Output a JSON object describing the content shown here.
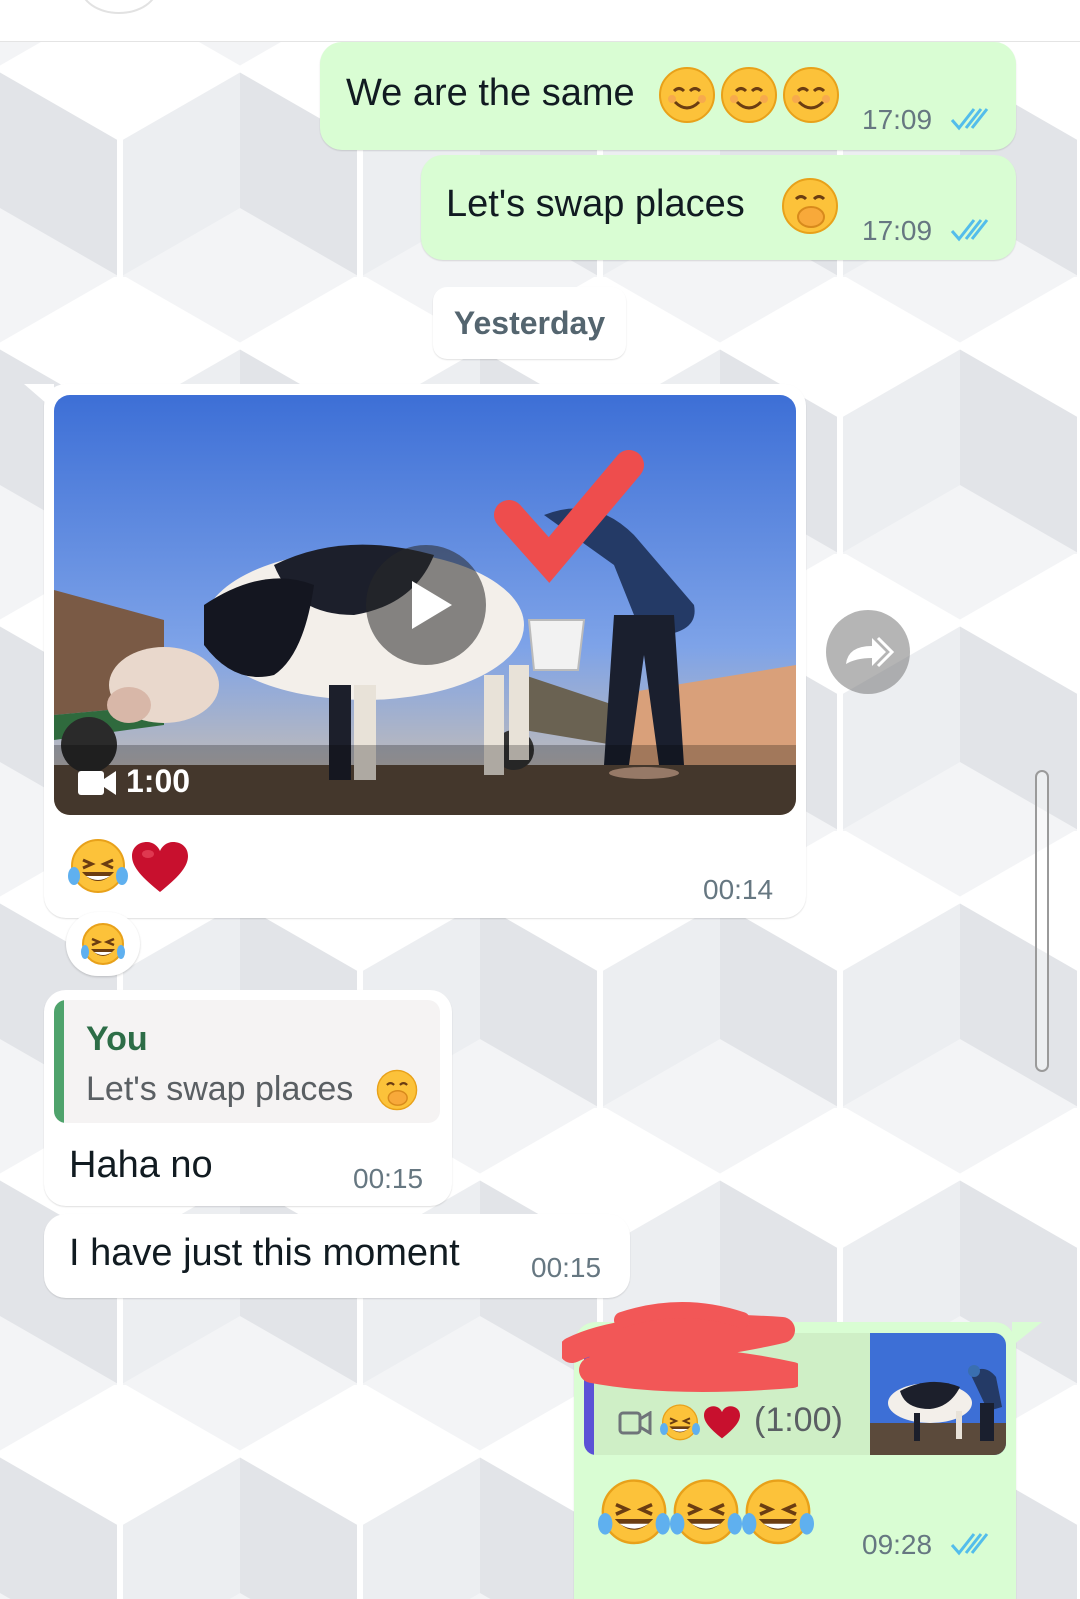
{
  "messages": [
    {
      "direction": "outgoing",
      "text": "We are the same",
      "emojis": [
        "smiling-face",
        "smiling-face",
        "smiling-face"
      ],
      "time": "17:09",
      "status": "read"
    },
    {
      "direction": "outgoing",
      "text": "Let's swap places",
      "emojis": [
        "face-with-hand-over-mouth"
      ],
      "time": "17:09",
      "status": "read"
    }
  ],
  "date_separator": "Yesterday",
  "video_message": {
    "direction": "incoming",
    "duration": "1:00",
    "caption_emojis": [
      "face-with-tears-of-joy",
      "red-heart"
    ],
    "time": "00:14",
    "reaction": "face-with-tears-of-joy"
  },
  "reply_message": {
    "direction": "incoming",
    "quoted_author": "You",
    "quoted_text": "Let's swap places",
    "text": "Haha no",
    "time": "00:15"
  },
  "plain_message": {
    "direction": "incoming",
    "text": "I have just this moment",
    "time": "00:15"
  },
  "last_message": {
    "direction": "outgoing",
    "quoted_text": "(1:00)",
    "emojis": [
      "face-with-tears-of-joy",
      "face-with-tears-of-joy",
      "face-with-tears-of-joy"
    ],
    "time": "09:28",
    "status": "read"
  },
  "colors": {
    "outgoing_bubble": "#d9fdd3",
    "incoming_bubble": "#ffffff",
    "read_ticks": "#53bdeb",
    "timestamp": "#667781",
    "quote_bar_incoming": "#4fa36c",
    "quote_bar_outgoing": "#5b52d6"
  }
}
